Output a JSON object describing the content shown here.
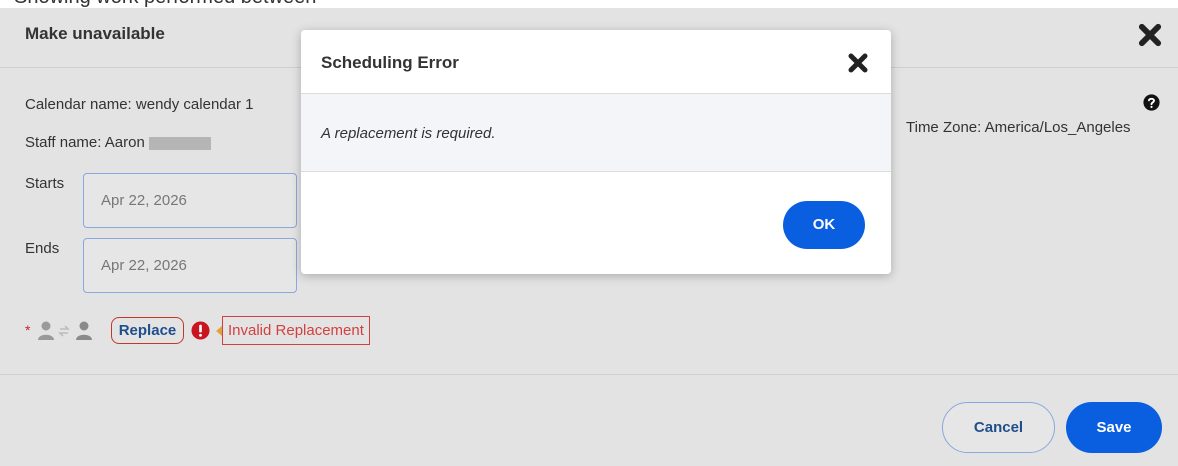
{
  "top_strip_text": "Showing work performed between",
  "background_dialog": {
    "title": "Make unavailable",
    "calendar_name": "Calendar name: wendy calendar 1",
    "staff_name": "Staff name: Aaron",
    "time_zone": "Time Zone: America/Los_Angeles",
    "starts_label": "Starts",
    "starts_value": "Apr 22, 2026",
    "ends_label": "Ends",
    "ends_value": "Apr 22, 2026",
    "required_marker": "*",
    "replace_label": "Replace",
    "invalid_label": "Invalid Replacement",
    "cancel_label": "Cancel",
    "save_label": "Save"
  },
  "modal": {
    "title": "Scheduling Error",
    "message": "A replacement is required.",
    "ok_label": "OK"
  },
  "icons": {
    "close": "close-icon",
    "help": "help-icon",
    "error": "error-icon",
    "people_swap": "person-swap-icon"
  },
  "colors": {
    "primary": "#0a5fe0",
    "error": "#d34040",
    "overlay": "#e3e3e3"
  }
}
